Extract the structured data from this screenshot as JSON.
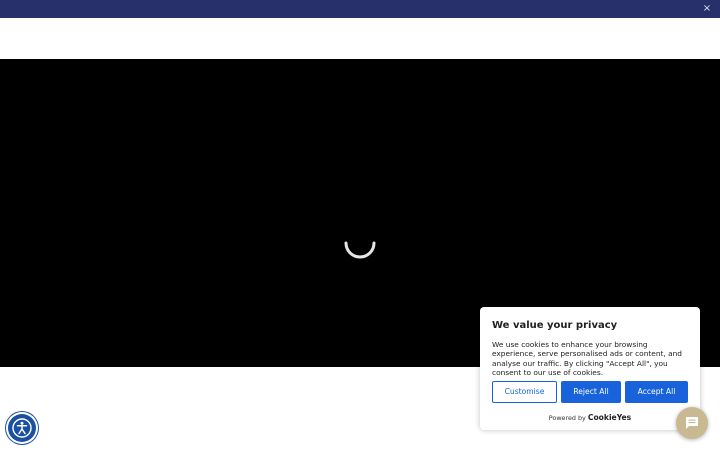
{
  "top_banner": {
    "close_label": "×"
  },
  "cookie_banner": {
    "title": "We value your privacy",
    "text": "We use cookies to enhance your browsing experience, serve personalised ads or content, and analyse our traffic. By clicking \"Accept All\", you consent to our use of cookies.",
    "customise_label": "Customise",
    "reject_label": "Reject All",
    "accept_label": "Accept All",
    "powered_by": "Powered by",
    "powered_logo": "CookieYes",
    "accent_color": "#1863dc"
  },
  "icons": {
    "accessibility": "accessibility-icon",
    "chat": "chat-icon",
    "loading": "loading-spinner-icon"
  },
  "colors": {
    "top_banner": "#27306b",
    "video_background": "#000000",
    "accessibility_button": "#1b4fa3",
    "chat_button": "#c9b992"
  }
}
